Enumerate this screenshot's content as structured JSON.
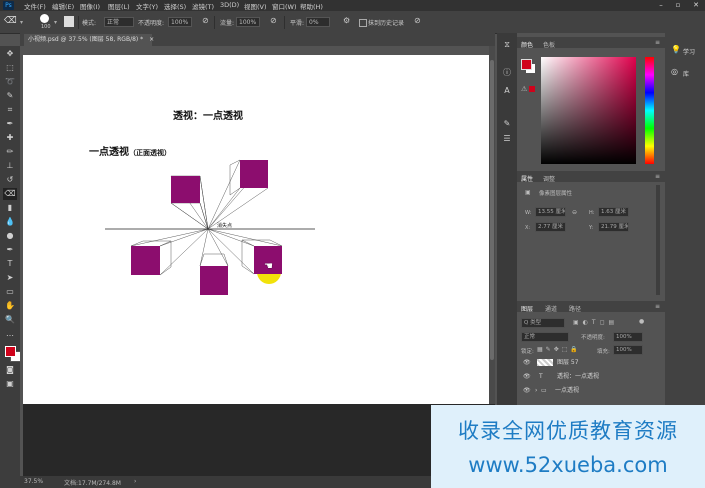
{
  "menubar": {
    "app_icon": "Ps",
    "items": [
      "文件(F)",
      "编辑(E)",
      "图像(I)",
      "图层(L)",
      "文字(Y)",
      "选择(S)",
      "滤镜(T)",
      "3D(D)",
      "视图(V)",
      "窗口(W)",
      "帮助(H)"
    ]
  },
  "options": {
    "brush_size": "100",
    "mode_label": "模式:",
    "mode_value": "正常",
    "opacity_label": "不透明度:",
    "opacity_value": "100%",
    "flow_label": "流量:",
    "flow_value": "100%",
    "smooth_label": "平滑:",
    "smooth_value": "0%",
    "history_label": "抹到历史记录"
  },
  "document": {
    "tab_title": "小视频.psd @ 37.5% (图层 58, RGB/8) *",
    "heading": "透视：一点透视",
    "subheading_main": "一点透视",
    "subheading_paren": "（正面透视）",
    "vanishing_label": "消失点"
  },
  "status": {
    "zoom": "37.5%",
    "doc_size": "文档:17.7M/274.8M"
  },
  "panels": {
    "color_tabs": [
      "颜色",
      "色板"
    ],
    "properties_tabs": [
      "属性",
      "调整"
    ],
    "properties_type": "像素图层属性",
    "w_label": "W:",
    "w_value": "13.55 厘米",
    "h_label": "H:",
    "h_value": "1.63 厘米",
    "x_label": "X:",
    "x_value": "2.77 厘米",
    "y_label": "Y:",
    "y_value": "21.79 厘米",
    "layers_tabs": [
      "图层",
      "通道",
      "路径"
    ],
    "kind_label": "Q 类型",
    "blend_mode": "正常",
    "opacity_label": "不透明度:",
    "opacity_value": "100%",
    "lock_label": "锁定:",
    "fill_label": "填充:",
    "fill_value": "100%",
    "layers": [
      "图层 57",
      "透视：一点透视",
      "一点透视"
    ]
  },
  "farright": {
    "learn": "学习",
    "libraries": "库"
  },
  "watermark": {
    "line1": "收录全网优质教育资源",
    "line2": "www.52xueba.com"
  },
  "colors": {
    "box_purple": "#8c0d6e",
    "yellow_cursor": "#f2e20a",
    "foreground": "#d0021b"
  }
}
